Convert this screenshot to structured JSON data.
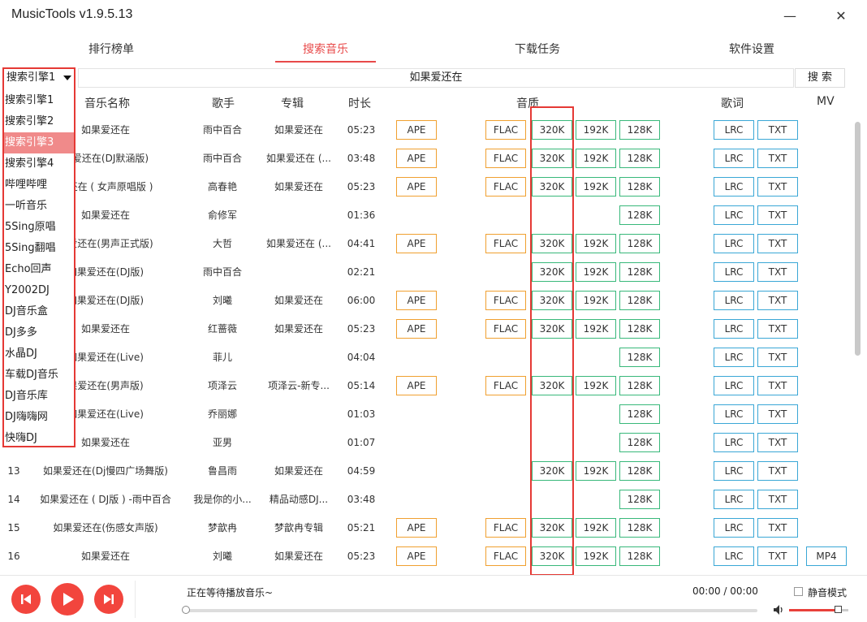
{
  "window": {
    "title": "MusicTools v1.9.5.13",
    "minimize": "—",
    "close": "✕"
  },
  "tabs": [
    {
      "label": "排行榜单",
      "active": false
    },
    {
      "label": "搜索音乐",
      "active": true
    },
    {
      "label": "下载任务",
      "active": false
    },
    {
      "label": "软件设置",
      "active": false
    }
  ],
  "search": {
    "engine": "搜索引擎1",
    "query": "如果爱还在",
    "button": "搜 索"
  },
  "engine_options": [
    "搜索引擎1",
    "搜索引擎2",
    "搜索引擎3",
    "搜索引擎4",
    "哔哩哔哩",
    "一听音乐",
    "5Sing原唱",
    "5Sing翻唱",
    "Echo回声",
    "Y2002DJ",
    "DJ音乐盒",
    "DJ多多",
    "水晶DJ",
    "车载DJ音乐",
    "DJ音乐库",
    "DJ嗨嗨网",
    "快嗨DJ"
  ],
  "engine_selected_index": 2,
  "table": {
    "headers": {
      "name": "音乐名称",
      "artist": "歌手",
      "album": "专辑",
      "duration": "时长",
      "quality": "音质",
      "lyrics": "歌词",
      "mv": "MV"
    },
    "rows": [
      {
        "num": "",
        "name": "如果爱还在",
        "artist": "雨中百合",
        "album": "如果爱还在",
        "duration": "05:23",
        "ape": "APE",
        "flac": "FLAC",
        "q320": "320K",
        "q192": "192K",
        "q128": "128K",
        "lrc": "LRC",
        "txt": "TXT",
        "mv": ""
      },
      {
        "num": "",
        "name": "果爱还在(DJ默涵版)",
        "artist": "雨中百合",
        "album": "如果爱还在 (...",
        "duration": "03:48",
        "ape": "APE",
        "flac": "FLAC",
        "q320": "320K",
        "q192": "192K",
        "q128": "128K",
        "lrc": "LRC",
        "txt": "TXT",
        "mv": ""
      },
      {
        "num": "",
        "name": "爱还在 ( 女声原唱版 )",
        "artist": "高春艳",
        "album": "如果爱还在",
        "duration": "05:23",
        "ape": "APE",
        "flac": "FLAC",
        "q320": "320K",
        "q192": "192K",
        "q128": "128K",
        "lrc": "LRC",
        "txt": "TXT",
        "mv": ""
      },
      {
        "num": "",
        "name": "如果爱还在",
        "artist": "俞修军",
        "album": "",
        "duration": "01:36",
        "ape": "",
        "flac": "",
        "q320": "",
        "q192": "",
        "q128": "128K",
        "lrc": "LRC",
        "txt": "TXT",
        "mv": ""
      },
      {
        "num": "",
        "name": "果爱还在(男声正式版)",
        "artist": "大哲",
        "album": "如果爱还在 (...",
        "duration": "04:41",
        "ape": "APE",
        "flac": "FLAC",
        "q320": "320K",
        "q192": "192K",
        "q128": "128K",
        "lrc": "LRC",
        "txt": "TXT",
        "mv": ""
      },
      {
        "num": "",
        "name": "如果爱还在(DJ版)",
        "artist": "雨中百合",
        "album": "",
        "duration": "02:21",
        "ape": "",
        "flac": "",
        "q320": "320K",
        "q192": "192K",
        "q128": "128K",
        "lrc": "LRC",
        "txt": "TXT",
        "mv": ""
      },
      {
        "num": "",
        "name": "如果爱还在(DJ版)",
        "artist": "刘曦",
        "album": "如果爱还在",
        "duration": "06:00",
        "ape": "APE",
        "flac": "FLAC",
        "q320": "320K",
        "q192": "192K",
        "q128": "128K",
        "lrc": "LRC",
        "txt": "TXT",
        "mv": ""
      },
      {
        "num": "",
        "name": "如果爱还在",
        "artist": "红蔷薇",
        "album": "如果爱还在",
        "duration": "05:23",
        "ape": "APE",
        "flac": "FLAC",
        "q320": "320K",
        "q192": "192K",
        "q128": "128K",
        "lrc": "LRC",
        "txt": "TXT",
        "mv": ""
      },
      {
        "num": "",
        "name": "如果爱还在(Live)",
        "artist": "菲儿",
        "album": "",
        "duration": "04:04",
        "ape": "",
        "flac": "",
        "q320": "",
        "q192": "",
        "q128": "128K",
        "lrc": "LRC",
        "txt": "TXT",
        "mv": ""
      },
      {
        "num": "",
        "name": "果爱还在(男声版)",
        "artist": "项泽云",
        "album": "项泽云-新专...",
        "duration": "05:14",
        "ape": "APE",
        "flac": "FLAC",
        "q320": "320K",
        "q192": "192K",
        "q128": "128K",
        "lrc": "LRC",
        "txt": "TXT",
        "mv": ""
      },
      {
        "num": "",
        "name": "如果爱还在(Live)",
        "artist": "乔丽娜",
        "album": "",
        "duration": "01:03",
        "ape": "",
        "flac": "",
        "q320": "",
        "q192": "",
        "q128": "128K",
        "lrc": "LRC",
        "txt": "TXT",
        "mv": ""
      },
      {
        "num": "",
        "name": "如果爱还在",
        "artist": "亚男",
        "album": "",
        "duration": "01:07",
        "ape": "",
        "flac": "",
        "q320": "",
        "q192": "",
        "q128": "128K",
        "lrc": "LRC",
        "txt": "TXT",
        "mv": ""
      },
      {
        "num": "13",
        "name": "如果爱还在(Dj慢四广场舞版)",
        "artist": "鲁昌雨",
        "album": "如果爱还在",
        "duration": "04:59",
        "ape": "",
        "flac": "",
        "q320": "320K",
        "q192": "192K",
        "q128": "128K",
        "lrc": "LRC",
        "txt": "TXT",
        "mv": ""
      },
      {
        "num": "14",
        "name": "如果爱还在 ( DJ版 ) -雨中百合",
        "artist": "我是你的小...",
        "album": "精品动感DJ...",
        "duration": "03:48",
        "ape": "",
        "flac": "",
        "q320": "",
        "q192": "",
        "q128": "128K",
        "lrc": "LRC",
        "txt": "TXT",
        "mv": ""
      },
      {
        "num": "15",
        "name": "如果爱还在(伤感女声版)",
        "artist": "梦歆冉",
        "album": "梦歆冉专辑",
        "duration": "05:21",
        "ape": "APE",
        "flac": "FLAC",
        "q320": "320K",
        "q192": "192K",
        "q128": "128K",
        "lrc": "LRC",
        "txt": "TXT",
        "mv": ""
      },
      {
        "num": "16",
        "name": "如果爱还在",
        "artist": "刘曦",
        "album": "如果爱还在",
        "duration": "05:23",
        "ape": "APE",
        "flac": "FLAC",
        "q320": "320K",
        "q192": "192K",
        "q128": "128K",
        "lrc": "LRC",
        "txt": "TXT",
        "mv": "MP4"
      }
    ]
  },
  "player": {
    "now_playing": "正在等待播放音乐~",
    "time": "00:00 / 00:00",
    "mute_label": "静音模式",
    "mute": false,
    "progress": 0,
    "volume": 0.92
  },
  "icons": {
    "prev": "skip-previous-icon",
    "play": "play-icon",
    "next": "skip-next-icon",
    "volume": "speaker-icon"
  },
  "colors": {
    "accent": "#e84a4a",
    "orange": "#f0a030",
    "green": "#38b87a",
    "blue": "#3aa7d6",
    "highlight": "#e53935"
  }
}
